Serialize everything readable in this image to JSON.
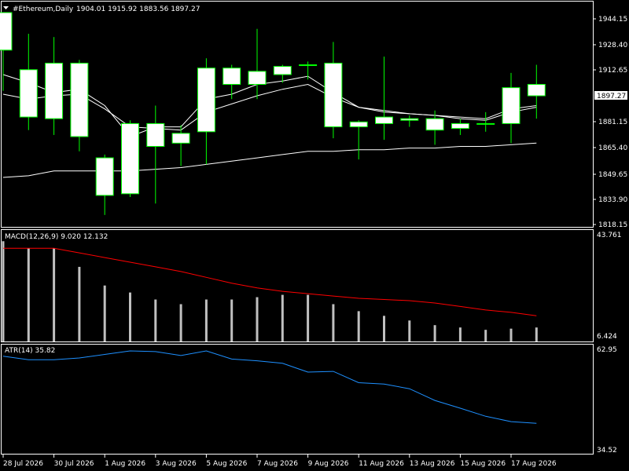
{
  "header": {
    "symbol": "#Ethereum,Daily",
    "ohlc": "1904.01 1915.92 1883.56 1897.27"
  },
  "colors": {
    "background": "#000000",
    "frame": "#ffffff",
    "bull_candle_body": "#ffffff",
    "candle_border": "#00ff00",
    "ma_lines": "#ffffff",
    "macd_histogram": "#c0c0c0",
    "macd_signal": "#ff0000",
    "atr_line": "#1e90ff",
    "price_label_bg": "#ffffff",
    "price_label_text": "#000000"
  },
  "price_axis": {
    "ticks": [
      "1944.15",
      "1928.40",
      "1912.65",
      "1897.27",
      "1881.15",
      "1865.40",
      "1849.65",
      "1833.90",
      "1818.15"
    ],
    "current_price": "1897.27"
  },
  "macd": {
    "label": "MACD(12,26,9) 9.020 12.132",
    "scale_top": "43.761",
    "scale_bottom": "6.424"
  },
  "atr": {
    "label": "ATR(14) 35.82",
    "scale_top": "62.95",
    "scale_bottom": "34.52"
  },
  "time_axis": {
    "labels": [
      "28 Jul 2026",
      "30 Jul 2026",
      "1 Aug 2026",
      "3 Aug 2026",
      "5 Aug 2026",
      "7 Aug 2026",
      "9 Aug 2026",
      "11 Aug 2026",
      "13 Aug 2026",
      "15 Aug 2026",
      "17 Aug 2026"
    ]
  },
  "chart_data": {
    "type": "candlestick",
    "instrument": "#Ethereum",
    "timeframe": "Daily",
    "price_range": [
      1818.15,
      1950
    ],
    "candles": [
      {
        "open": 1925,
        "high": 1942,
        "low": 1900,
        "close": 1948
      },
      {
        "open": 1884,
        "high": 1935,
        "low": 1876,
        "close": 1913
      },
      {
        "open": 1883,
        "high": 1933,
        "low": 1873,
        "close": 1917
      },
      {
        "open": 1872,
        "high": 1919,
        "low": 1863,
        "close": 1917
      },
      {
        "open": 1836,
        "high": 1861,
        "low": 1824,
        "close": 1859
      },
      {
        "open": 1837,
        "high": 1882,
        "low": 1835,
        "close": 1880
      },
      {
        "open": 1866,
        "high": 1891,
        "low": 1831,
        "close": 1880
      },
      {
        "open": 1868,
        "high": 1879,
        "low": 1854,
        "close": 1874
      },
      {
        "open": 1875,
        "high": 1920,
        "low": 1855,
        "close": 1914
      },
      {
        "open": 1904,
        "high": 1916,
        "low": 1895,
        "close": 1914
      },
      {
        "open": 1904,
        "high": 1938,
        "low": 1895,
        "close": 1912
      },
      {
        "open": 1910,
        "high": 1916,
        "low": 1905,
        "close": 1915
      },
      {
        "open": 1916,
        "high": 1918,
        "low": 1907,
        "close": 1916
      },
      {
        "open": 1878,
        "high": 1930,
        "low": 1871,
        "close": 1917
      },
      {
        "open": 1878,
        "high": 1882,
        "low": 1858,
        "close": 1881
      },
      {
        "open": 1880,
        "high": 1921,
        "low": 1870,
        "close": 1884
      },
      {
        "open": 1882,
        "high": 1885,
        "low": 1878,
        "close": 1883
      },
      {
        "open": 1876,
        "high": 1888,
        "low": 1867,
        "close": 1883
      },
      {
        "open": 1877,
        "high": 1883,
        "low": 1873,
        "close": 1880
      },
      {
        "open": 1880,
        "high": 1887,
        "low": 1875,
        "close": 1880
      },
      {
        "open": 1880,
        "high": 1911,
        "low": 1868,
        "close": 1902
      },
      {
        "open": 1897,
        "high": 1916,
        "low": 1883,
        "close": 1904
      }
    ],
    "moving_averages": [
      {
        "values": [
          1910,
          1905,
          1899,
          1901,
          1891,
          1872,
          1878,
          1878,
          1895,
          1898,
          1904,
          1906,
          1909,
          1899,
          1890,
          1887,
          1886,
          1885,
          1884,
          1883,
          1889,
          1891
        ]
      },
      {
        "values": [
          1898,
          1895,
          1897,
          1898,
          1889,
          1878,
          1877,
          1876,
          1887,
          1892,
          1897,
          1901,
          1904,
          1896,
          1890,
          1888,
          1886,
          1885,
          1883,
          1882,
          1887,
          1890
        ]
      },
      {
        "values": [
          1847,
          1848,
          1851,
          1851,
          1851,
          1851,
          1852,
          1853,
          1855,
          1857,
          1859,
          1861,
          1863,
          1863,
          1864,
          1864,
          1865,
          1865,
          1866,
          1866,
          1867,
          1868
        ]
      }
    ],
    "macd_histogram": [
      43,
      40,
      40,
      32,
      24,
      21,
      18,
      16,
      18,
      18,
      19,
      20,
      20,
      16,
      13,
      11,
      9,
      7,
      6,
      5,
      5.5,
      6
    ],
    "macd_signal": [
      40,
      40,
      40,
      38,
      36,
      34,
      32,
      30,
      27.5,
      25,
      23,
      21.5,
      20.5,
      19.5,
      18.5,
      18,
      17.5,
      16.5,
      15,
      13.5,
      12.5,
      11
    ],
    "atr": [
      61,
      60,
      60,
      60.5,
      61.5,
      62.5,
      62.3,
      61.2,
      62.5,
      60.2,
      59.7,
      59,
      56.5,
      56.7,
      53.5,
      53.1,
      51.8,
      48.5,
      46.3,
      44,
      42.5,
      42
    ]
  }
}
